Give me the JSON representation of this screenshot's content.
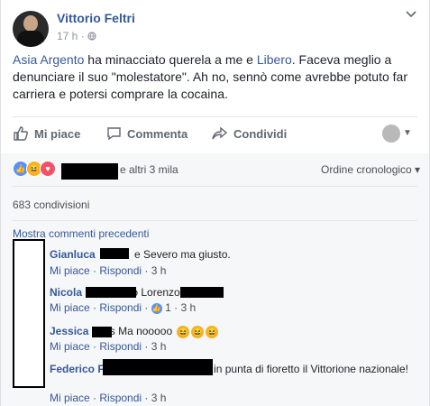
{
  "post": {
    "author": "Vittorio Feltri",
    "time": "17 h",
    "dot": "·",
    "text_a": "Asia Argento",
    "text_b": " ha minacciato querela a me e ",
    "text_c": "Libero",
    "text_d": ". Faceva meglio a denunciare il suo \"molestatore\". Ah no, sennò come avrebbe potuto far carriera e potersi comprare la cocaina."
  },
  "actions": {
    "like": "Mi piace",
    "comment": "Commenta",
    "share": "Condividi"
  },
  "reactions": {
    "others": "e altri 3 mila",
    "order": "Ordine cronologico ▾",
    "shares": "683 condivisioni",
    "prev": "Mostra commenti precedenti"
  },
  "comments": [
    {
      "name": "Gianluca",
      "text": "e Severo ma giusto.",
      "like": "Mi piace",
      "reply": "Rispondi",
      "sep": "·",
      "time": "3 h"
    },
    {
      "name": "Nicola",
      "text": "o Lorenzo",
      "like": "Mi piace",
      "reply": "Rispondi",
      "sep": "·",
      "count": "1",
      "time": "3 h"
    },
    {
      "name": "Jessica",
      "text": "s Ma nooooo",
      "like": "Mi piace",
      "reply": "Rispondi",
      "sep": "·",
      "time": "3 h"
    },
    {
      "name": "Federico",
      "name_tail": "F",
      "text": "in punta di fioretto il Vittorione nazionale!",
      "like": "Mi piace",
      "reply": "Rispondi",
      "sep": "·",
      "time": "3 h"
    }
  ],
  "icons": [
    "chevron-down-icon",
    "globe-icon",
    "like-icon",
    "comment-icon",
    "share-icon"
  ]
}
